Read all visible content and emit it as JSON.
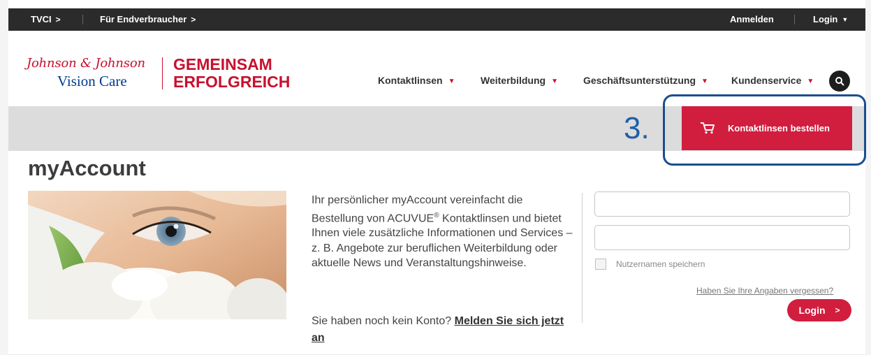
{
  "topbar": {
    "link_tvci": "TVCI",
    "link_consumer": "Für Endverbraucher",
    "chevron": ">",
    "signin": "Anmelden",
    "login": "Login",
    "caret": "▼"
  },
  "logo": {
    "brand_line": "Johnson & Johnson",
    "sub_line": "Vision Care",
    "tagline_1": "GEMEINSAM",
    "tagline_2": "ERFOLGREICH"
  },
  "nav": {
    "caret": "▼",
    "items": [
      {
        "label": "Kontaktlinsen"
      },
      {
        "label": "Weiterbildung"
      },
      {
        "label": "Geschäftsunterstützung"
      },
      {
        "label": "Kundenservice"
      }
    ],
    "search_icon": "search-icon"
  },
  "annotation": {
    "step": "3."
  },
  "order_button": {
    "label": "Kontaktlinsen bestellen",
    "icon": "cart-icon"
  },
  "page": {
    "title": "myAccount"
  },
  "intro": {
    "text_1": "Ihr persönlicher myAccount vereinfacht die Bestellung von ACUVUE",
    "reg": "®",
    "text_2": " Kontaktlinsen und bietet Ihnen viele zusätzliche Informationen und Services – z. B. Angebote zur beruflichen Weiterbildung oder aktuelle News und Veranstaltungshinweise.",
    "signup_prefix": "Sie haben noch kein Konto? ",
    "signup_link": "Melden Sie sich jetzt an"
  },
  "login_form": {
    "username_value": "",
    "password_value": "",
    "remember_label": "Nutzernamen speichern",
    "forgot_link": "Haben Sie Ihre Angaben vergessen?",
    "submit_label": "Login",
    "submit_chevron": ">"
  },
  "colors": {
    "brand_red": "#d11e3e",
    "topbar_bg": "#2b2b2b",
    "band_bg": "#dcdcdc",
    "annotation_blue": "#1a4f8f"
  }
}
